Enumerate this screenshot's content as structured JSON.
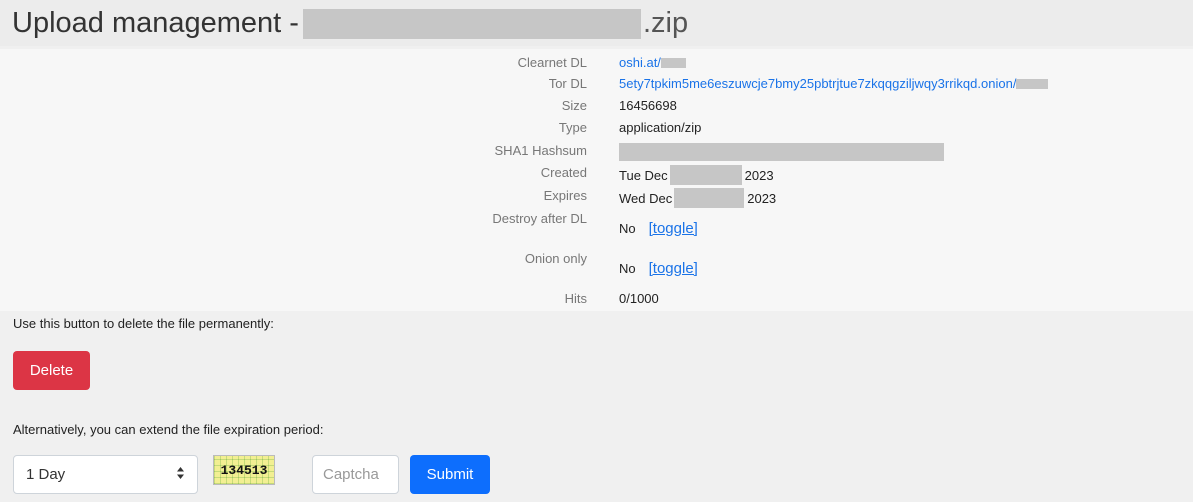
{
  "header": {
    "title_prefix": "Upload management - ",
    "title_suffix": ".zip"
  },
  "file_info": {
    "clearnet_label": "Clearnet DL",
    "clearnet_value": "oshi.at/",
    "tor_label": "Tor DL",
    "tor_value": "5ety7tpkim5me6eszuwcje7bmy25pbtrjtue7zkqqgziljwqy3rrikqd.onion/",
    "size_label": "Size",
    "size_value": "16456698",
    "type_label": "Type",
    "type_value": "application/zip",
    "sha1_label": "SHA1 Hashsum",
    "created_label": "Created",
    "created_day": "Tue Dec",
    "created_year": "2023",
    "expires_label": "Expires",
    "expires_day": "Wed Dec",
    "expires_year": "2023",
    "destroy_label": "Destroy after DL",
    "destroy_value": "No",
    "onion_label": "Onion only",
    "onion_value": "No",
    "toggle_label": "[toggle]",
    "hits_label": "Hits",
    "hits_value": "0/1000"
  },
  "delete_section": {
    "help_text": "Use this button to delete the file permanently:",
    "delete_label": "Delete"
  },
  "extend_section": {
    "help_text": "Alternatively, you can extend the file expiration period:",
    "period_selected": "1 Day",
    "captcha_code": "134513",
    "captcha_placeholder": "Captcha",
    "submit_label": "Submit"
  }
}
